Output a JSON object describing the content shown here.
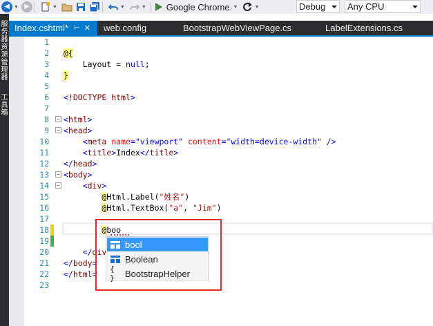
{
  "toolbar": {
    "run_target": "Google Chrome",
    "configuration": "Debug",
    "platform": "Any CPU"
  },
  "side_strip": {
    "items": [
      {
        "label": "服务器资源管理器"
      },
      {
        "label": "工具箱"
      }
    ]
  },
  "tabs": [
    {
      "label": "Index.cshtml*",
      "active": true,
      "pin": "⊢",
      "close": "✕"
    },
    {
      "label": "web.config",
      "active": false
    },
    {
      "label": "BootstrapWebViewPage.cs",
      "active": false
    },
    {
      "label": "LabelExtensions.cs",
      "active": false
    }
  ],
  "editor": {
    "line_numbers": [
      "1",
      "2",
      "3",
      "4",
      "5",
      "6",
      "7",
      "8",
      "9",
      "10",
      "11",
      "12",
      "13",
      "14",
      "15",
      "16",
      "17",
      "18",
      "19",
      "20",
      "21",
      "22",
      "23"
    ],
    "lines": [
      [],
      [
        {
          "t": "@{",
          "k": "razor"
        }
      ],
      [
        {
          "t": "    Layout = ",
          "k": "plain"
        },
        {
          "t": "null",
          "k": "kw"
        },
        {
          "t": ";",
          "k": "plain"
        }
      ],
      [
        {
          "t": "}",
          "k": "razor"
        }
      ],
      [],
      [
        {
          "t": "<",
          "k": "punct"
        },
        {
          "t": "!DOCTYPE html",
          "k": "doctype"
        },
        {
          "t": ">",
          "k": "punct"
        }
      ],
      [],
      [
        {
          "t": "<",
          "k": "punct"
        },
        {
          "t": "html",
          "k": "tag"
        },
        {
          "t": ">",
          "k": "punct"
        }
      ],
      [
        {
          "t": "<",
          "k": "punct"
        },
        {
          "t": "head",
          "k": "tag"
        },
        {
          "t": ">",
          "k": "punct"
        }
      ],
      [
        {
          "t": "    <",
          "k": "punct"
        },
        {
          "t": "meta",
          "k": "tag"
        },
        {
          "t": " name",
          "k": "attr"
        },
        {
          "t": "=\"viewport\"",
          "k": "val"
        },
        {
          "t": " content",
          "k": "attr"
        },
        {
          "t": "=\"width=device-width\"",
          "k": "val"
        },
        {
          "t": " />",
          "k": "punct"
        }
      ],
      [
        {
          "t": "    <",
          "k": "punct"
        },
        {
          "t": "title",
          "k": "tag"
        },
        {
          "t": ">",
          "k": "punct"
        },
        {
          "t": "Index",
          "k": "plain"
        },
        {
          "t": "</",
          "k": "punct"
        },
        {
          "t": "title",
          "k": "tag"
        },
        {
          "t": ">",
          "k": "punct"
        }
      ],
      [
        {
          "t": "</",
          "k": "punct"
        },
        {
          "t": "head",
          "k": "tag"
        },
        {
          "t": ">",
          "k": "punct"
        }
      ],
      [
        {
          "t": "<",
          "k": "punct"
        },
        {
          "t": "body",
          "k": "tag"
        },
        {
          "t": ">",
          "k": "punct"
        }
      ],
      [
        {
          "t": "    <",
          "k": "punct"
        },
        {
          "t": "div",
          "k": "tag"
        },
        {
          "t": ">",
          "k": "punct"
        }
      ],
      [
        {
          "t": "        ",
          "k": "plain"
        },
        {
          "t": "@",
          "k": "razor"
        },
        {
          "t": "Html.Label(",
          "k": "plain"
        },
        {
          "t": "\"姓名\"",
          "k": "str"
        },
        {
          "t": ")",
          "k": "plain"
        }
      ],
      [
        {
          "t": "        ",
          "k": "plain"
        },
        {
          "t": "@",
          "k": "razor"
        },
        {
          "t": "Html.TextBox(",
          "k": "plain"
        },
        {
          "t": "\"a\"",
          "k": "str"
        },
        {
          "t": ", ",
          "k": "plain"
        },
        {
          "t": "\"Jim\"",
          "k": "str"
        },
        {
          "t": ")",
          "k": "plain"
        }
      ],
      [],
      [
        {
          "t": "        ",
          "k": "plain"
        },
        {
          "t": "@",
          "k": "razor"
        },
        {
          "t": "boo",
          "k": "plain"
        }
      ],
      [],
      [
        {
          "t": "    </",
          "k": "punct"
        },
        {
          "t": "div",
          "k": "tag"
        },
        {
          "t": ">",
          "k": "punct"
        }
      ],
      [
        {
          "t": "</",
          "k": "punct"
        },
        {
          "t": "body",
          "k": "tag"
        },
        {
          "t": ">",
          "k": "punct"
        }
      ],
      [
        {
          "t": "</",
          "k": "punct"
        },
        {
          "t": "html",
          "k": "tag"
        },
        {
          "t": ">",
          "k": "punct"
        }
      ],
      []
    ],
    "fold_marks": {
      "7": "⊟",
      "8": "⊟",
      "12": "⊟",
      "13": "⊟"
    }
  },
  "completion": {
    "items": [
      {
        "label": "bool",
        "icon": "struct-icon",
        "selected": true
      },
      {
        "label": "Boolean",
        "icon": "struct-icon",
        "selected": false
      },
      {
        "label": "BootstrapHelper",
        "icon": "namespace-icon",
        "glyph": "{ }",
        "selected": false
      }
    ]
  },
  "colors": {
    "accent": "#007acc",
    "annotation": "#e52a2a",
    "selection": "#3399ff",
    "line_number": "#2b91af"
  }
}
